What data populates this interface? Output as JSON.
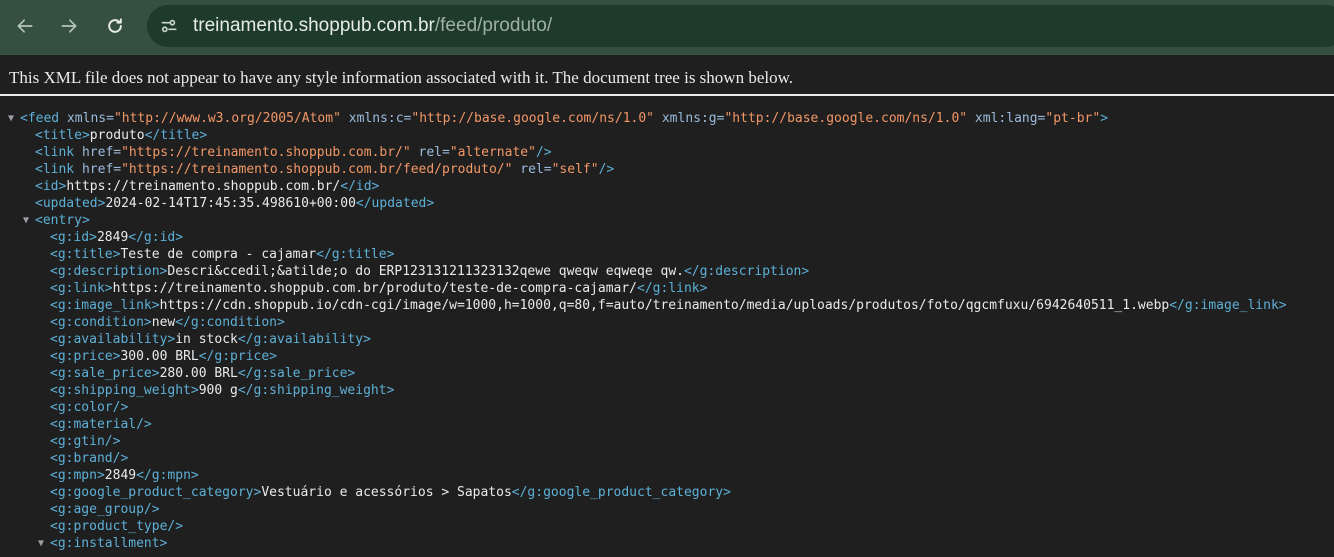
{
  "toolbar": {
    "back_icon": "arrow-left-icon",
    "forward_icon": "arrow-right-icon",
    "reload_icon": "reload-icon",
    "url_host": "treinamento.shoppub.com.br",
    "url_path": "/feed/produto/"
  },
  "notice": "This XML file does not appear to have any style information associated with it. The document tree is shown below.",
  "xml_lines": [
    {
      "indent": 0,
      "toggle": "expanded",
      "parts": [
        [
          "tag",
          "<feed "
        ],
        [
          "attr",
          "xmlns="
        ],
        [
          "val",
          "\"http://www.w3.org/2005/Atom\""
        ],
        [
          "attr",
          " xmlns:c="
        ],
        [
          "val",
          "\"http://base.google.com/ns/1.0\""
        ],
        [
          "attr",
          " xmlns:g="
        ],
        [
          "val",
          "\"http://base.google.com/ns/1.0\""
        ],
        [
          "attr",
          " xml:lang="
        ],
        [
          "val",
          "\"pt-br\""
        ],
        [
          "tag",
          ">"
        ]
      ]
    },
    {
      "indent": 1,
      "parts": [
        [
          "tag",
          "<title>"
        ],
        [
          "txt",
          "produto"
        ],
        [
          "tag",
          "</title>"
        ]
      ]
    },
    {
      "indent": 1,
      "parts": [
        [
          "tag",
          "<link "
        ],
        [
          "attr",
          "href="
        ],
        [
          "val",
          "\"https://treinamento.shoppub.com.br/\""
        ],
        [
          "attr",
          " rel="
        ],
        [
          "val",
          "\"alternate\""
        ],
        [
          "tag",
          "/>"
        ]
      ]
    },
    {
      "indent": 1,
      "parts": [
        [
          "tag",
          "<link "
        ],
        [
          "attr",
          "href="
        ],
        [
          "val",
          "\"https://treinamento.shoppub.com.br/feed/produto/\""
        ],
        [
          "attr",
          " rel="
        ],
        [
          "val",
          "\"self\""
        ],
        [
          "tag",
          "/>"
        ]
      ]
    },
    {
      "indent": 1,
      "parts": [
        [
          "tag",
          "<id>"
        ],
        [
          "txt",
          "https://treinamento.shoppub.com.br/"
        ],
        [
          "tag",
          "</id>"
        ]
      ]
    },
    {
      "indent": 1,
      "parts": [
        [
          "tag",
          "<updated>"
        ],
        [
          "txt",
          "2024-02-14T17:45:35.498610+00:00"
        ],
        [
          "tag",
          "</updated>"
        ]
      ]
    },
    {
      "indent": 1,
      "toggle": "expanded",
      "parts": [
        [
          "tag",
          "<entry>"
        ]
      ]
    },
    {
      "indent": 2,
      "parts": [
        [
          "tag",
          "<g:id>"
        ],
        [
          "txt",
          "2849"
        ],
        [
          "tag",
          "</g:id>"
        ]
      ]
    },
    {
      "indent": 2,
      "parts": [
        [
          "tag",
          "<g:title>"
        ],
        [
          "txt",
          "Teste de compra - cajamar"
        ],
        [
          "tag",
          "</g:title>"
        ]
      ]
    },
    {
      "indent": 2,
      "parts": [
        [
          "tag",
          "<g:description>"
        ],
        [
          "txt",
          "Descri&ccedil;&atilde;o do ERP123131211323132qewe qweqw eqweqe qw."
        ],
        [
          "tag",
          "</g:description>"
        ]
      ]
    },
    {
      "indent": 2,
      "parts": [
        [
          "tag",
          "<g:link>"
        ],
        [
          "txt",
          "https://treinamento.shoppub.com.br/produto/teste-de-compra-cajamar/"
        ],
        [
          "tag",
          "</g:link>"
        ]
      ]
    },
    {
      "indent": 2,
      "parts": [
        [
          "tag",
          "<g:image_link>"
        ],
        [
          "txt",
          "https://cdn.shoppub.io/cdn-cgi/image/w=1000,h=1000,q=80,f=auto/treinamento/media/uploads/produtos/foto/qgcmfuxu/6942640511_1.webp"
        ],
        [
          "tag",
          "</g:image_link>"
        ]
      ]
    },
    {
      "indent": 2,
      "parts": [
        [
          "tag",
          "<g:condition>"
        ],
        [
          "txt",
          "new"
        ],
        [
          "tag",
          "</g:condition>"
        ]
      ]
    },
    {
      "indent": 2,
      "parts": [
        [
          "tag",
          "<g:availability>"
        ],
        [
          "txt",
          "in stock"
        ],
        [
          "tag",
          "</g:availability>"
        ]
      ]
    },
    {
      "indent": 2,
      "parts": [
        [
          "tag",
          "<g:price>"
        ],
        [
          "txt",
          "300.00 BRL"
        ],
        [
          "tag",
          "</g:price>"
        ]
      ]
    },
    {
      "indent": 2,
      "parts": [
        [
          "tag",
          "<g:sale_price>"
        ],
        [
          "txt",
          "280.00 BRL"
        ],
        [
          "tag",
          "</g:sale_price>"
        ]
      ]
    },
    {
      "indent": 2,
      "parts": [
        [
          "tag",
          "<g:shipping_weight>"
        ],
        [
          "txt",
          "900 g"
        ],
        [
          "tag",
          "</g:shipping_weight>"
        ]
      ]
    },
    {
      "indent": 2,
      "parts": [
        [
          "tag",
          "<g:color/>"
        ]
      ]
    },
    {
      "indent": 2,
      "parts": [
        [
          "tag",
          "<g:material/>"
        ]
      ]
    },
    {
      "indent": 2,
      "parts": [
        [
          "tag",
          "<g:gtin/>"
        ]
      ]
    },
    {
      "indent": 2,
      "parts": [
        [
          "tag",
          "<g:brand/>"
        ]
      ]
    },
    {
      "indent": 2,
      "parts": [
        [
          "tag",
          "<g:mpn>"
        ],
        [
          "txt",
          "2849"
        ],
        [
          "tag",
          "</g:mpn>"
        ]
      ]
    },
    {
      "indent": 2,
      "parts": [
        [
          "tag",
          "<g:google_product_category>"
        ],
        [
          "txt",
          "Vestuário e acessórios > Sapatos"
        ],
        [
          "tag",
          "</g:google_product_category>"
        ]
      ]
    },
    {
      "indent": 2,
      "parts": [
        [
          "tag",
          "<g:age_group/>"
        ]
      ]
    },
    {
      "indent": 2,
      "parts": [
        [
          "tag",
          "<g:product_type/>"
        ]
      ]
    },
    {
      "indent": 2,
      "toggle": "expanded",
      "parts": [
        [
          "tag",
          "<g:installment>"
        ]
      ]
    }
  ]
}
